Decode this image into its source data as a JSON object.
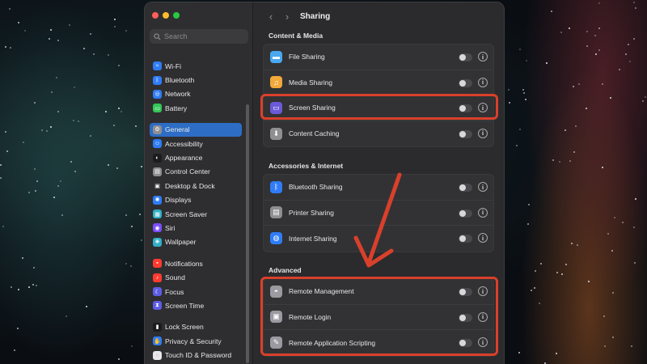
{
  "window": {
    "page_title": "Sharing",
    "back_arrow": "‹",
    "forward_arrow": "›"
  },
  "search": {
    "placeholder": "Search"
  },
  "sidebar": {
    "groups": [
      [
        {
          "label": "Wi-Fi",
          "icon": "wifi-icon",
          "color": "#2f7cf6",
          "glyph": "≈"
        },
        {
          "label": "Bluetooth",
          "icon": "bluetooth-icon",
          "color": "#2f7cf6",
          "glyph": "ᛒ"
        },
        {
          "label": "Network",
          "icon": "network-icon",
          "color": "#2f7cf6",
          "glyph": "◎"
        },
        {
          "label": "Battery",
          "icon": "battery-icon",
          "color": "#34c759",
          "glyph": "▭"
        }
      ],
      [
        {
          "label": "General",
          "icon": "gear-icon",
          "color": "#8e8e93",
          "glyph": "⚙",
          "active": true
        },
        {
          "label": "Accessibility",
          "icon": "accessibility-icon",
          "color": "#2f7cf6",
          "glyph": "☺"
        },
        {
          "label": "Appearance",
          "icon": "appearance-icon",
          "color": "#1c1c1e",
          "glyph": "◐"
        },
        {
          "label": "Control Center",
          "icon": "control-center-icon",
          "color": "#8e8e93",
          "glyph": "▤"
        },
        {
          "label": "Desktop & Dock",
          "icon": "desktop-dock-icon",
          "color": "#2f2f33",
          "glyph": "▣"
        },
        {
          "label": "Displays",
          "icon": "displays-icon",
          "color": "#2f7cf6",
          "glyph": "✺"
        },
        {
          "label": "Screen Saver",
          "icon": "screen-saver-icon",
          "color": "#30b0c7",
          "glyph": "▦"
        },
        {
          "label": "Siri",
          "icon": "siri-icon",
          "color": "#7c4dff",
          "glyph": "◉"
        },
        {
          "label": "Wallpaper",
          "icon": "wallpaper-icon",
          "color": "#30b0c7",
          "glyph": "❋"
        }
      ],
      [
        {
          "label": "Notifications",
          "icon": "notifications-icon",
          "color": "#ff3b30",
          "glyph": "▪"
        },
        {
          "label": "Sound",
          "icon": "sound-icon",
          "color": "#ff3b30",
          "glyph": "♪"
        },
        {
          "label": "Focus",
          "icon": "focus-icon",
          "color": "#5e5ce6",
          "glyph": "☾"
        },
        {
          "label": "Screen Time",
          "icon": "screen-time-icon",
          "color": "#5e5ce6",
          "glyph": "⧗"
        }
      ],
      [
        {
          "label": "Lock Screen",
          "icon": "lock-screen-icon",
          "color": "#1c1c1e",
          "glyph": "▮"
        },
        {
          "label": "Privacy & Security",
          "icon": "privacy-icon",
          "color": "#2f7cf6",
          "glyph": "✋"
        },
        {
          "label": "Touch ID & Password",
          "icon": "touch-id-icon",
          "color": "#e8e8ea",
          "glyph": "◌"
        }
      ]
    ]
  },
  "sections": [
    {
      "title": "Content & Media",
      "rows": [
        {
          "label": "File Sharing",
          "icon": "file-sharing-icon",
          "color": "#4aa8f0",
          "glyph": "▬"
        },
        {
          "label": "Media Sharing",
          "icon": "media-sharing-icon",
          "color": "#f2a93b",
          "glyph": "♫"
        },
        {
          "label": "Screen Sharing",
          "icon": "screen-sharing-icon",
          "color": "#6a5ad8",
          "glyph": "▭"
        },
        {
          "label": "Content Caching",
          "icon": "content-caching-icon",
          "color": "#8e8e93",
          "glyph": "⬇"
        }
      ]
    },
    {
      "title": "Accessories & Internet",
      "rows": [
        {
          "label": "Bluetooth Sharing",
          "icon": "bluetooth-sharing-icon",
          "color": "#2f7cf6",
          "glyph": "ᛒ"
        },
        {
          "label": "Printer Sharing",
          "icon": "printer-sharing-icon",
          "color": "#8e8e93",
          "glyph": "▤"
        },
        {
          "label": "Internet Sharing",
          "icon": "internet-sharing-icon",
          "color": "#2f7cf6",
          "glyph": "◍"
        }
      ]
    },
    {
      "title": "Advanced",
      "rows": [
        {
          "label": "Remote Management",
          "icon": "remote-management-icon",
          "color": "#9a9aa0",
          "glyph": "◓"
        },
        {
          "label": "Remote Login",
          "icon": "remote-login-icon",
          "color": "#9a9aa0",
          "glyph": "▣"
        },
        {
          "label": "Remote Application Scripting",
          "icon": "remote-scripting-icon",
          "color": "#9a9aa0",
          "glyph": "✎"
        }
      ]
    }
  ],
  "toggles_on": false,
  "info_glyph": "i",
  "annotation_color": "#d9402b"
}
